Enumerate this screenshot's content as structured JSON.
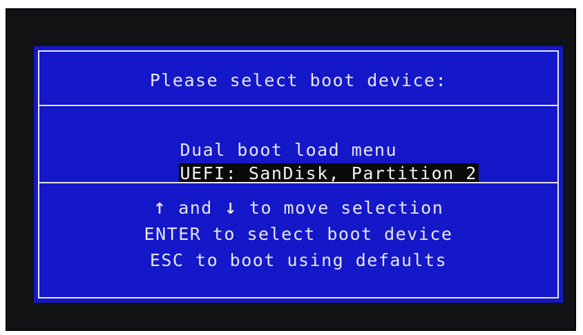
{
  "dialog": {
    "title": "Please select boot device:"
  },
  "menu": {
    "items": [
      {
        "label": "Dual boot load menu",
        "selected": false
      },
      {
        "label": "UEFI: SanDisk, Partition 2",
        "selected": true
      }
    ]
  },
  "help": {
    "line1_up_arrow": "↑",
    "line1_and": " and ",
    "line1_down_arrow": "↓",
    "line1_rest": " to move selection",
    "line2": "ENTER to select boot device",
    "line3": "ESC to boot using defaults"
  },
  "colors": {
    "screen_background": "#1418c8",
    "text": "#e6e6f2",
    "selection_background": "#0a0a0a"
  }
}
